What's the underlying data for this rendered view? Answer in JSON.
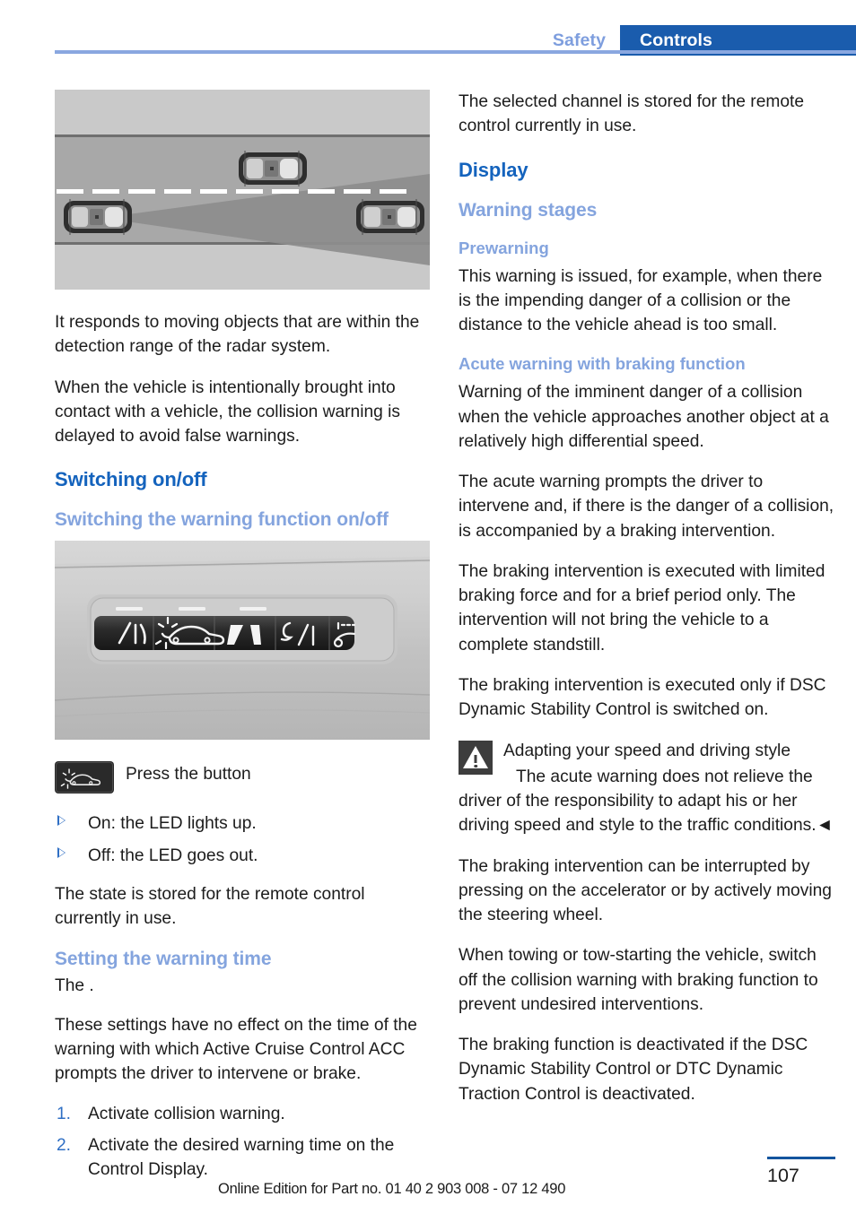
{
  "header": {
    "tab_inactive": "Safety",
    "tab_active": "Controls",
    "accent_blue": "#1a5cad",
    "rule_blue": "#8aa7e0"
  },
  "left_column": {
    "figure_road": {
      "alt": "Top-down illustration of a road with three cars and the radar detection cone of the front vehicle",
      "cars": 3,
      "lane_marking": "dashed-center-line"
    },
    "paragraph_1": "It responds to moving objects that are within the detection range of the radar system.",
    "paragraph_2": "When the vehicle is intentionally brought into contact with a vehicle, the collision warning is delayed to avoid false warnings.",
    "heading_switching": "Switching on/off",
    "subheading_switching_warning": "Switching the warning function on/off",
    "figure_panel": {
      "alt": "Dashboard button panel with five dark buttons and white symbols",
      "buttons": 5,
      "highlighted_button_index": 2
    },
    "button_caption": "Press the button",
    "button_icon_name": "collision-warning-button-icon",
    "bullets": [
      "On: the LED lights up.",
      "Off: the LED goes out."
    ],
    "paragraph_3": "The state is stored for the remote control currently in use.",
    "subheading_warning_time": "Setting the warning time",
    "paragraph_4": "The .",
    "paragraph_5": "These settings have no effect on the time of the warning with which Active Cruise Control ACC prompts the driver to intervene or brake.",
    "steps": [
      {
        "num": "1.",
        "text": "Activate collision warning."
      },
      {
        "num": "2.",
        "text": "Activate the desired warning time on the Control Display."
      }
    ]
  },
  "right_column": {
    "paragraph_1": "The selected channel is stored for the remote control currently in use.",
    "heading_display": "Display",
    "subheading_warning_stages": "Warning stages",
    "subsub_prewarning": "Prewarning",
    "paragraph_2": "This warning is issued, for example, when there is the impending danger of a collision or the distance to the vehicle ahead is too small.",
    "subsub_acute": "Acute warning with braking function",
    "paragraph_3": "Warning of the imminent danger of a collision when the vehicle approaches another object at a relatively high differential speed.",
    "paragraph_4": "The acute warning prompts the driver to intervene and, if there is the danger of a collision, is accompanied by a braking intervention.",
    "paragraph_5": "The braking intervention is executed with limited braking force and for a brief period only. The intervention will not bring the vehicle to a complete standstill.",
    "paragraph_6": "The braking intervention is executed only if DSC Dynamic Stability Control is switched on.",
    "warning": {
      "icon_name": "warning-triangle-icon",
      "title": "Adapting your speed and driving style",
      "body": "The acute warning does not relieve the driver of the responsibility to adapt his or her driving speed and style to the traffic conditions.◄"
    },
    "paragraph_7": "The braking intervention can be interrupted by pressing on the accelerator or by actively moving the steering wheel.",
    "paragraph_8": "When towing or tow-starting the vehicle, switch off the collision warning with braking function to prevent undesired interventions.",
    "paragraph_9": "The braking function is deactivated if the DSC Dynamic Stability Control or DTC Dynamic Traction Control is deactivated."
  },
  "footer": {
    "note": "Online Edition for Part no. 01 40 2 903 008 - 07 12 490",
    "page_number": "107"
  }
}
